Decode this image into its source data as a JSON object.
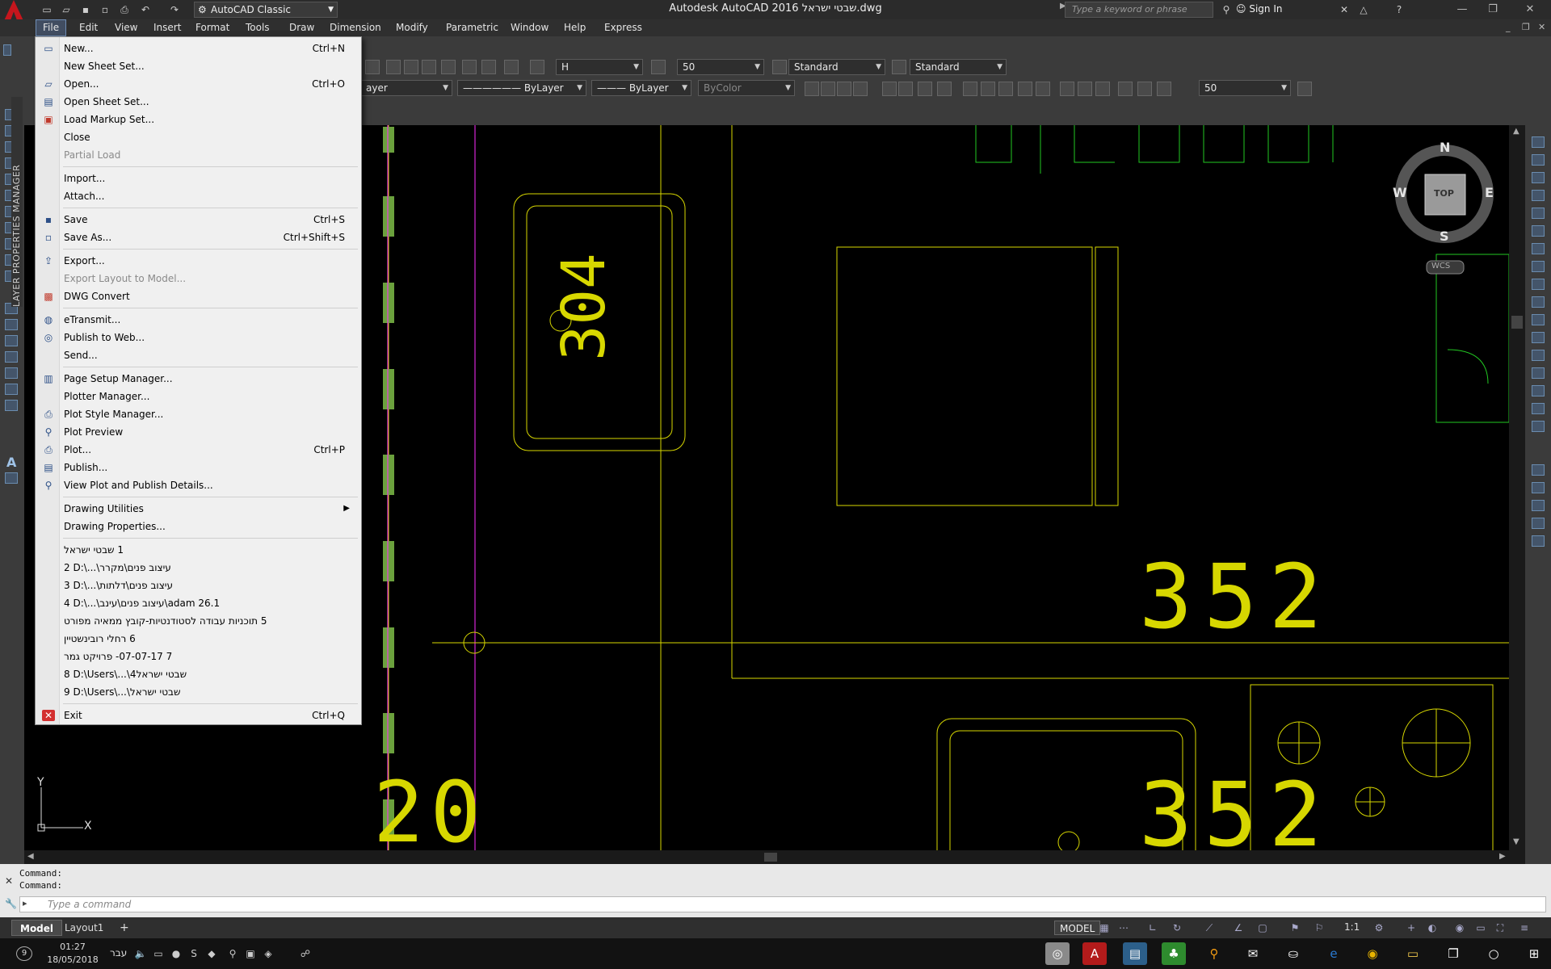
{
  "titlebar": {
    "workspace": "AutoCAD Classic",
    "title": "Autodesk AutoCAD 2016   שבטי ישראל.dwg",
    "search_placeholder": "Type a keyword or phrase",
    "signin": "Sign In"
  },
  "menubar": {
    "items": [
      "File",
      "Edit",
      "View",
      "Insert",
      "Format",
      "Tools",
      "Draw",
      "Dimension",
      "Modify",
      "Parametric",
      "Window",
      "Help",
      "Express"
    ]
  },
  "toolbar": {
    "text_style": "H",
    "dim_scale": "50",
    "dim_style": "Standard",
    "table_style": "Standard",
    "layer": "ayer",
    "linetype": "ByLayer",
    "lineweight": "ByLayer",
    "color": "ByColor",
    "scale2": "50"
  },
  "side_palette": {
    "label": "LAYER PROPERTIES MANAGER"
  },
  "file_menu": {
    "items": [
      {
        "label": "New...",
        "shortcut": "Ctrl+N",
        "icon": "new-file-icon"
      },
      {
        "label": "New Sheet Set...",
        "shortcut": "",
        "icon": ""
      },
      {
        "label": "Open...",
        "shortcut": "Ctrl+O",
        "icon": "open-folder-icon"
      },
      {
        "label": "Open Sheet Set...",
        "shortcut": "",
        "icon": "open-sheet-set-icon"
      },
      {
        "label": "Load Markup Set...",
        "shortcut": "",
        "icon": "markup-icon"
      },
      {
        "label": "Close",
        "shortcut": "",
        "icon": ""
      },
      {
        "label": "Partial Load",
        "shortcut": "",
        "icon": "",
        "disabled": true
      },
      {
        "label": "Import...",
        "shortcut": "",
        "icon": ""
      },
      {
        "label": "Attach...",
        "shortcut": "",
        "icon": ""
      },
      {
        "label": "Save",
        "shortcut": "Ctrl+S",
        "icon": "save-icon"
      },
      {
        "label": "Save As...",
        "shortcut": "Ctrl+Shift+S",
        "icon": "save-as-icon"
      },
      {
        "label": "Export...",
        "shortcut": "",
        "icon": "export-icon"
      },
      {
        "label": "Export Layout to Model...",
        "shortcut": "",
        "icon": "",
        "disabled": true
      },
      {
        "label": "DWG Convert",
        "shortcut": "",
        "icon": "dwg-convert-icon"
      },
      {
        "label": "eTransmit...",
        "shortcut": "",
        "icon": "etransmit-icon"
      },
      {
        "label": "Publish to Web...",
        "shortcut": "",
        "icon": "publish-web-icon"
      },
      {
        "label": "Send...",
        "shortcut": "",
        "icon": ""
      },
      {
        "label": "Page Setup Manager...",
        "shortcut": "",
        "icon": "page-setup-icon"
      },
      {
        "label": "Plotter Manager...",
        "shortcut": "",
        "icon": ""
      },
      {
        "label": "Plot Style Manager...",
        "shortcut": "",
        "icon": "plot-style-icon"
      },
      {
        "label": "Plot Preview",
        "shortcut": "",
        "icon": "plot-preview-icon"
      },
      {
        "label": "Plot...",
        "shortcut": "Ctrl+P",
        "icon": "plot-icon"
      },
      {
        "label": "Publish...",
        "shortcut": "",
        "icon": "publish-icon"
      },
      {
        "label": "View Plot and Publish Details...",
        "shortcut": "",
        "icon": "plot-details-icon"
      },
      {
        "label": "Drawing Utilities",
        "shortcut": "",
        "icon": "",
        "submenu": true
      },
      {
        "label": "Drawing Properties...",
        "shortcut": "",
        "icon": ""
      }
    ],
    "recent": [
      "1 שבטי ישראל",
      "2 D:\\...\\עיצוב פנים\\מקרר",
      "3 D:\\...\\עיצוב פנים\\דלתות",
      "4 D:\\...\\עיצוב פנים\\עינב\\adam 26.1",
      "5 תוכניות עבודה לסטודנטיות-קובץ ממאיה מפורט",
      "6 רחלי רובינשטיין",
      "7 07-07-17- פרויקט גמר",
      "8 D:\\Users\\...\\שבטי ישראל4",
      "9 D:\\Users\\...\\שבטי ישראל"
    ],
    "exit": {
      "label": "Exit",
      "shortcut": "Ctrl+Q"
    }
  },
  "drawing": {
    "numbers": [
      "304",
      "352",
      "352",
      "20"
    ],
    "viewcube": {
      "n": "N",
      "s": "S",
      "e": "E",
      "w": "W",
      "top": "TOP",
      "wcs": "WCS"
    },
    "ucs": {
      "x": "X",
      "y": "Y"
    }
  },
  "command": {
    "history": [
      "Command:",
      "Command:"
    ],
    "placeholder": "Type a command"
  },
  "status": {
    "tabs": [
      "Model",
      "Layout1"
    ],
    "mode": "MODEL",
    "scale": "1:1"
  },
  "taskbar": {
    "time": "01:27",
    "date": "18/05/2018",
    "lang": "עבר",
    "badge": "9"
  }
}
